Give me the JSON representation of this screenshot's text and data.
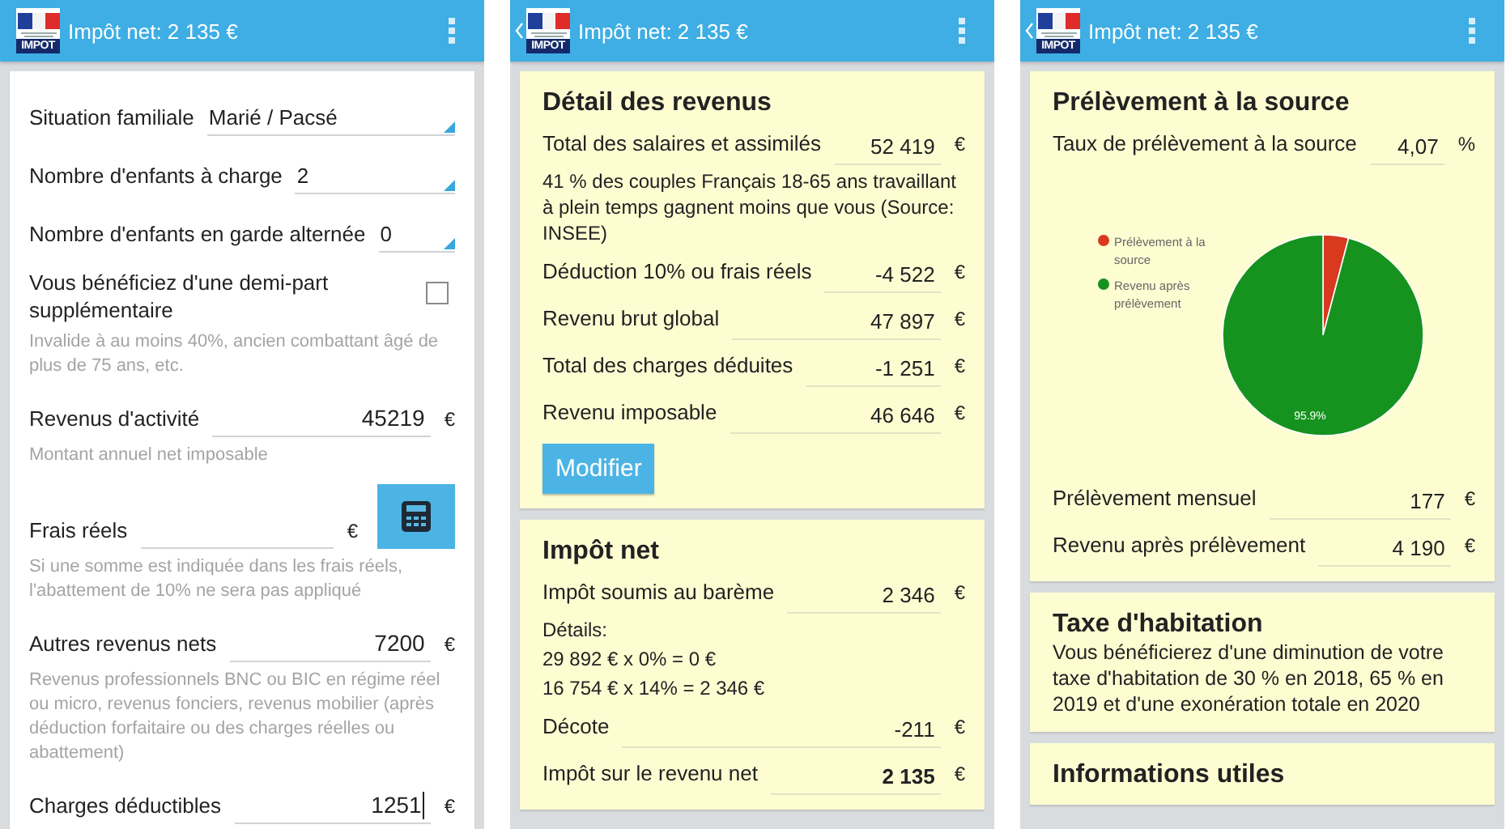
{
  "phones": [
    {
      "header": {
        "title": "Impôt net: 2 135 €",
        "logo_text": "IMPOT",
        "back": false
      },
      "kind": "form",
      "items": [
        {
          "kind": "select",
          "label": "Situation familiale",
          "value": "Marié / Pacsé"
        },
        {
          "kind": "select",
          "label": "Nombre d'enfants à charge",
          "value": "2"
        },
        {
          "kind": "select",
          "label": "Nombre d'enfants en garde alternée",
          "value": "0"
        },
        {
          "kind": "checkbox",
          "label": "Vous bénéficiez d'une demi-part supplémentaire",
          "checked": false,
          "hint": "Invalide à au moins 40%, ancien combattant âgé de plus de 75 ans, etc."
        },
        {
          "kind": "amount",
          "label": "Revenus d'activité",
          "value": "45219",
          "unit": "€",
          "hint": "Montant annuel net imposable"
        },
        {
          "kind": "amount",
          "label": "Frais réels",
          "unit": "€",
          "calculator": true,
          "hint": "Si une somme est indiquée dans les frais réels, l'abattement de 10% ne sera pas appliqué"
        },
        {
          "kind": "amount",
          "label": "Autres revenus nets",
          "value": "7200",
          "unit": "€",
          "hint": "Revenus professionnels BNC ou BIC en régime réel ou micro, revenus fonciers, revenus mobilier (après déduction forfaitaire ou des charges réelles ou abattement)"
        },
        {
          "kind": "amount",
          "label": "Charges déductibles",
          "value": "1251",
          "unit": "€",
          "focused": true
        }
      ]
    },
    {
      "header": {
        "title": "Impôt net: 2 135 €",
        "logo_text": "IMPOT",
        "back": true
      },
      "kind": "cards",
      "cards": [
        {
          "title": "Détail des revenus",
          "items": [
            {
              "kind": "row",
              "label": "Total des salaires et assimilés",
              "value": "52 419",
              "unit": "€"
            },
            {
              "kind": "text",
              "text": "41 % des couples Français 18-65 ans travaillant à plein temps gagnent moins que vous (Source: INSEE)"
            },
            {
              "kind": "row",
              "label": "Déduction 10% ou frais réels",
              "value": "-4 522",
              "unit": "€"
            },
            {
              "kind": "row",
              "label": "Revenu brut global",
              "value": "47 897",
              "unit": "€"
            },
            {
              "kind": "row",
              "label": "Total des charges déduites",
              "value": "-1 251",
              "unit": "€"
            },
            {
              "kind": "row",
              "label": "Revenu imposable",
              "value": "46 646",
              "unit": "€"
            },
            {
              "kind": "button",
              "label": "Modifier"
            }
          ]
        },
        {
          "title": "Impôt net",
          "items": [
            {
              "kind": "row",
              "label": "Impôt soumis au barème",
              "value": "2 346",
              "unit": "€"
            },
            {
              "kind": "text",
              "text": "Détails:"
            },
            {
              "kind": "text",
              "text": "29 892 € x 0% = 0 €"
            },
            {
              "kind": "text",
              "text": "16 754 € x 14% = 2 346 €"
            },
            {
              "kind": "row",
              "label": "Décote",
              "value": "-211",
              "unit": "€"
            },
            {
              "kind": "row",
              "label": "Impôt sur le revenu net",
              "value": "2 135",
              "unit": "€",
              "emphasis": true
            }
          ]
        }
      ]
    },
    {
      "header": {
        "title": "Impôt net: 2 135 €",
        "logo_text": "IMPOT",
        "back": true
      },
      "kind": "cards",
      "cards": [
        {
          "title": "Prélèvement à la source",
          "items": [
            {
              "kind": "row",
              "label": "Taux de prélèvement à la source",
              "value": "4,07",
              "unit": "%"
            },
            {
              "kind": "chart",
              "chart_data": {
                "type": "pie",
                "categories": [
                  "Prélèvement à la source",
                  "Revenu après prélèvement"
                ],
                "values": [
                  4.1,
                  95.9
                ],
                "colors": [
                  "#d8391f",
                  "#16921f"
                ],
                "value_labels": [
                  null,
                  "95.9%"
                ],
                "legend": "left"
              }
            },
            {
              "kind": "row",
              "label": "Prélèvement mensuel",
              "value": "177",
              "unit": "€"
            },
            {
              "kind": "row",
              "label": "Revenu après prélèvement",
              "value": "4 190",
              "unit": "€"
            }
          ]
        },
        {
          "title": "Taxe d'habitation",
          "items": [
            {
              "kind": "text",
              "text": "Vous bénéficierez d'une diminution de votre taxe d'habitation de 30 % en 2018, 65 % en 2019 et d'une exonération totale en 2020",
              "large": true
            }
          ]
        },
        {
          "title": "Informations utiles"
        }
      ]
    }
  ]
}
